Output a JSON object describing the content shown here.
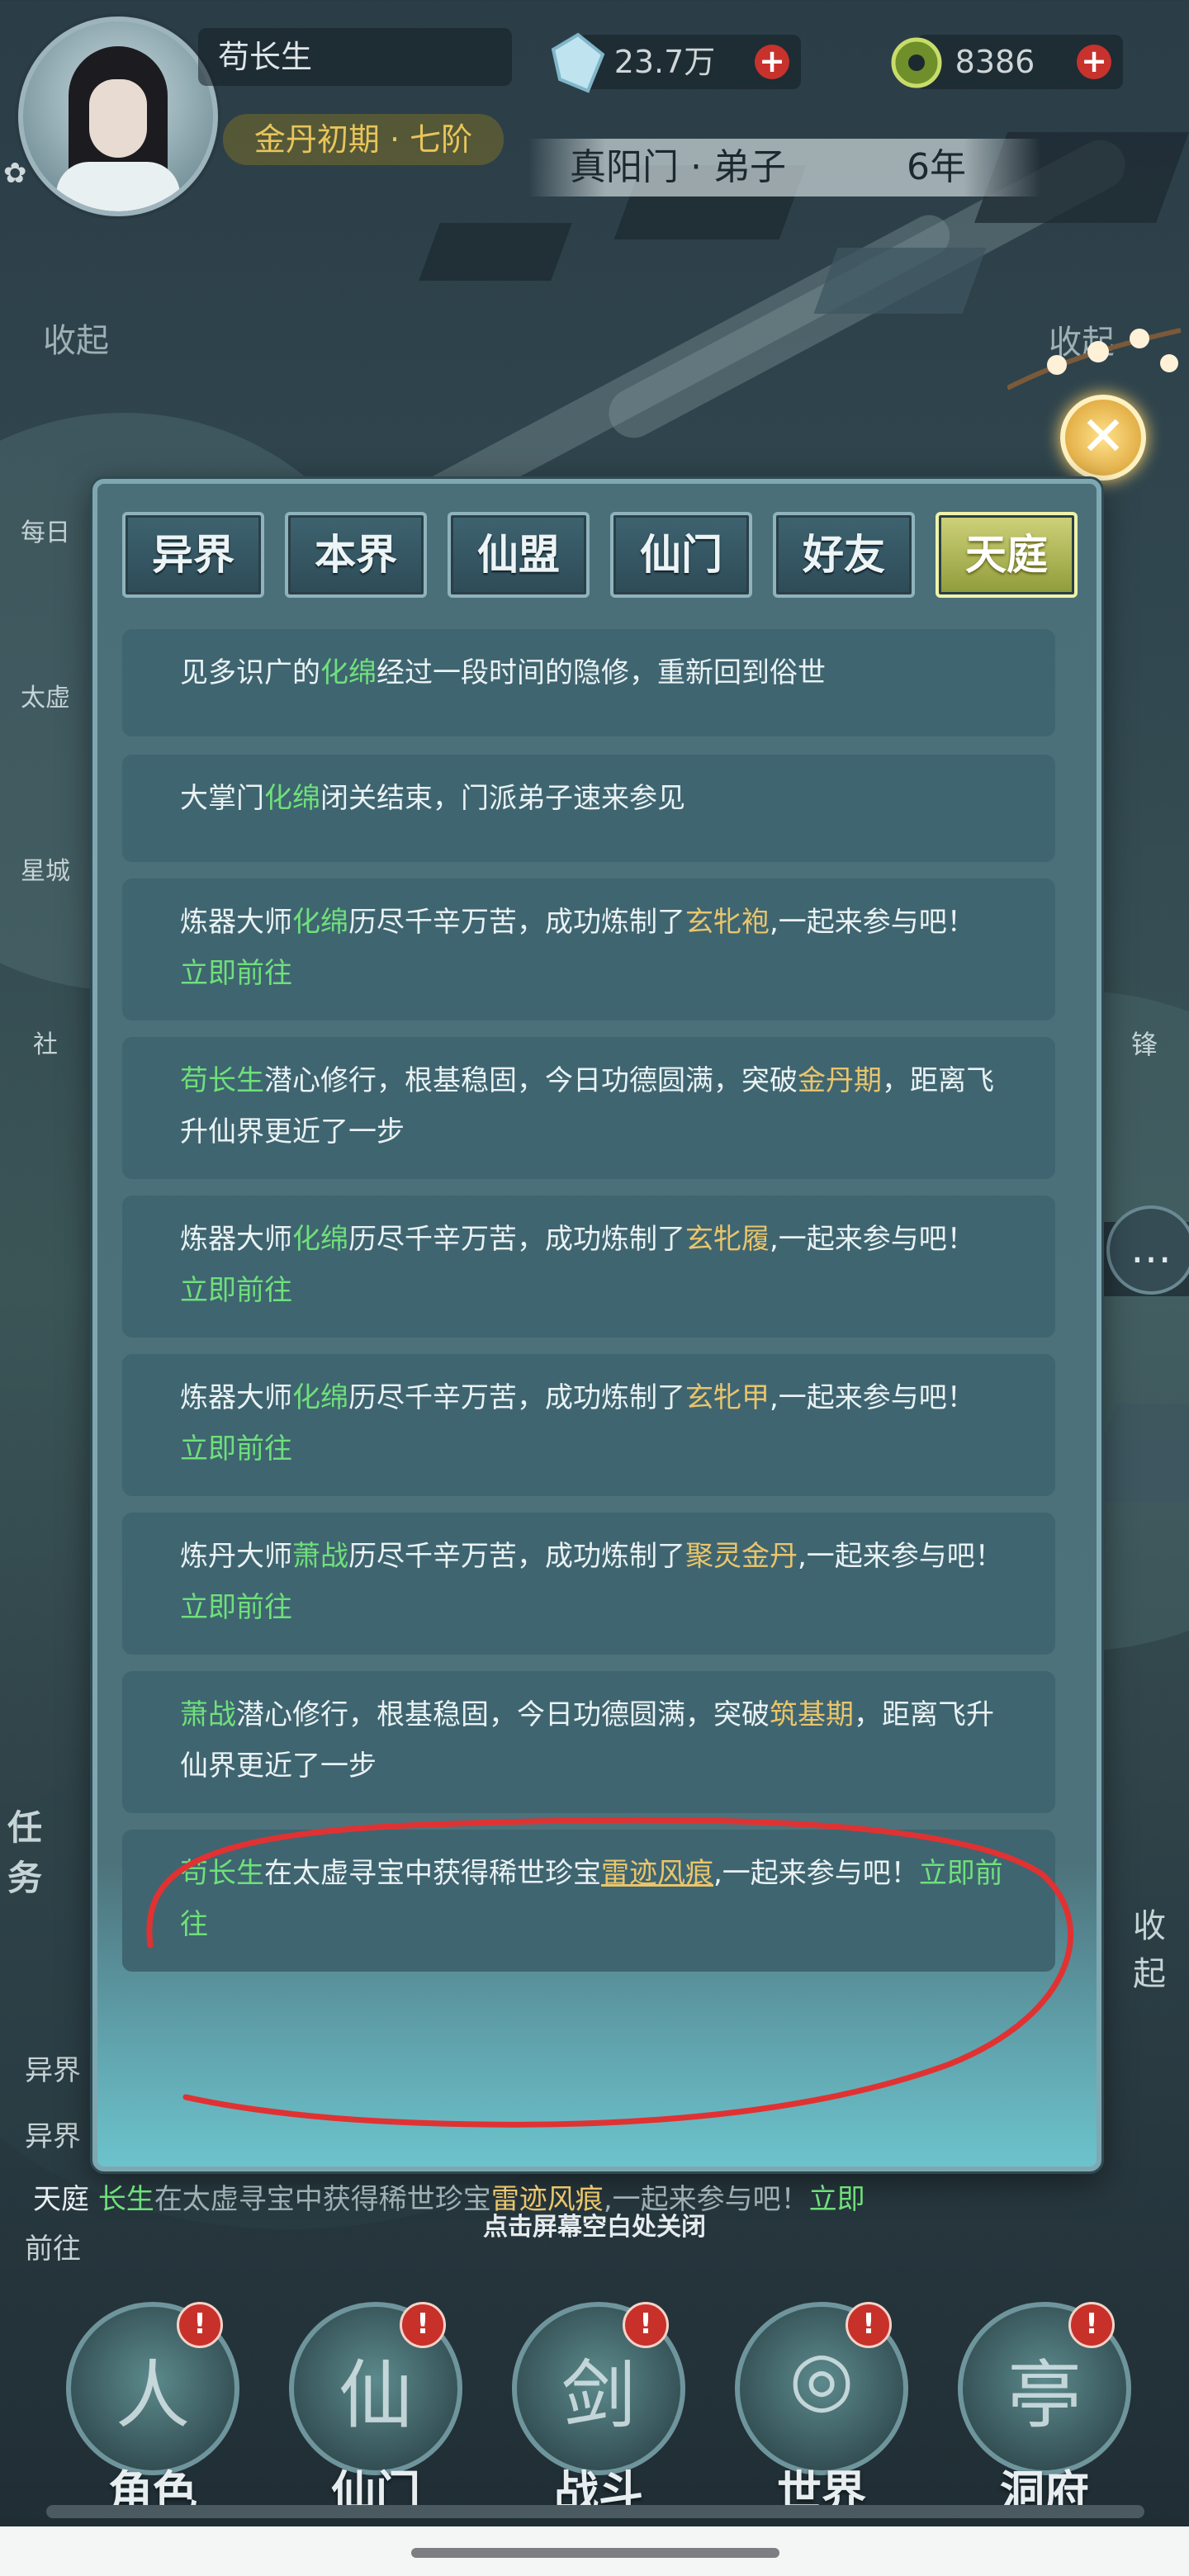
{
  "header": {
    "player_name": "苟长生",
    "rank": "金丹初期 · 七阶",
    "spirit_stones": "23.7万",
    "jade": "8386",
    "location": "真阳门 · 弟子",
    "years": "6年",
    "plus": "+",
    "collapse_left": "收起",
    "collapse_right": "收起",
    "close_icon": "✕",
    "settings_icon": "✿"
  },
  "side_left": [
    {
      "label": "每日"
    },
    {
      "label": "太虚"
    },
    {
      "label": "星城"
    },
    {
      "label": "社"
    },
    {
      "label": "任务"
    }
  ],
  "side_right": {
    "label_a": "锋",
    "collapse": "收起"
  },
  "tabs": [
    {
      "label": "异界",
      "active": false
    },
    {
      "label": "本界",
      "active": false
    },
    {
      "label": "仙盟",
      "active": false
    },
    {
      "label": "仙门",
      "active": false
    },
    {
      "label": "好友",
      "active": false
    },
    {
      "label": "天庭",
      "active": true
    }
  ],
  "messages": [
    {
      "p1": "见多识广的",
      "n1": "化绵",
      "p2": "经过一段时间的隐修，重新回到俗世"
    },
    {
      "p1": "大掌门",
      "n1": "化绵",
      "p2": "闭关结束，门派弟子速来参见"
    },
    {
      "p1": "炼器大师",
      "n1": "化绵",
      "p2": "历尽千辛万苦，成功炼制了",
      "item": "玄牝袍",
      "p3": ",一起来参与吧！",
      "link": "立即前往"
    },
    {
      "n1": "苟长生",
      "p1": "潜心修行，根基稳固，今日功德圆满，突破",
      "item": "金丹期",
      "p2": "，距离飞升仙界更近了一步"
    },
    {
      "p1": "炼器大师",
      "n1": "化绵",
      "p2": "历尽千辛万苦，成功炼制了",
      "item": "玄牝履",
      "p3": ",一起来参与吧！",
      "link": "立即前往"
    },
    {
      "p1": "炼器大师",
      "n1": "化绵",
      "p2": "历尽千辛万苦，成功炼制了",
      "item": "玄牝甲",
      "p3": ",一起来参与吧！",
      "link": "立即前往"
    },
    {
      "p1": "炼丹大师",
      "n1": "萧战",
      "p2": "历尽千辛万苦，成功炼制了",
      "item": "聚灵金丹",
      "p3": ",一起来参与吧！",
      "link": "立即前往"
    },
    {
      "n1": "萧战",
      "p1": "潜心修行，根基稳固，今日功德圆满，突破",
      "item": "筑基期",
      "p2": "，距离飞升仙界更近了一步"
    },
    {
      "n1": "苟长生",
      "p1": "在太虚寻宝中获得稀世珍宝",
      "item": "雷迹风痕",
      "p2": ",一起来参与吧！",
      "link": "立即前往"
    }
  ],
  "hint": "点击屏幕空白处关闭",
  "chat": {
    "line1_tag": "异界",
    "line2_tag": "异界",
    "line3_tag": "天庭",
    "line3_name": "长生",
    "line3_text": "在太虚寻宝中获得稀世珍宝",
    "line3_item": "雷迹风痕",
    "line3_tail": ",一起来参与吧！",
    "line3_link_a": "立即",
    "line3_link_b": "前往"
  },
  "nav": [
    {
      "label": "角色",
      "badge": "!",
      "glyph": "人"
    },
    {
      "label": "仙门",
      "badge": "!",
      "glyph": "仙"
    },
    {
      "label": "战斗",
      "badge": "!",
      "glyph": "剑"
    },
    {
      "label": "世界",
      "badge": "!",
      "glyph": "◎"
    },
    {
      "label": "洞府",
      "badge": "!",
      "glyph": "亭"
    }
  ],
  "colors": {
    "name_green": "#6fe07a",
    "item_gold": "#e9c56b",
    "active_tab": "#cfd27a",
    "annotation_red": "#e03232"
  }
}
